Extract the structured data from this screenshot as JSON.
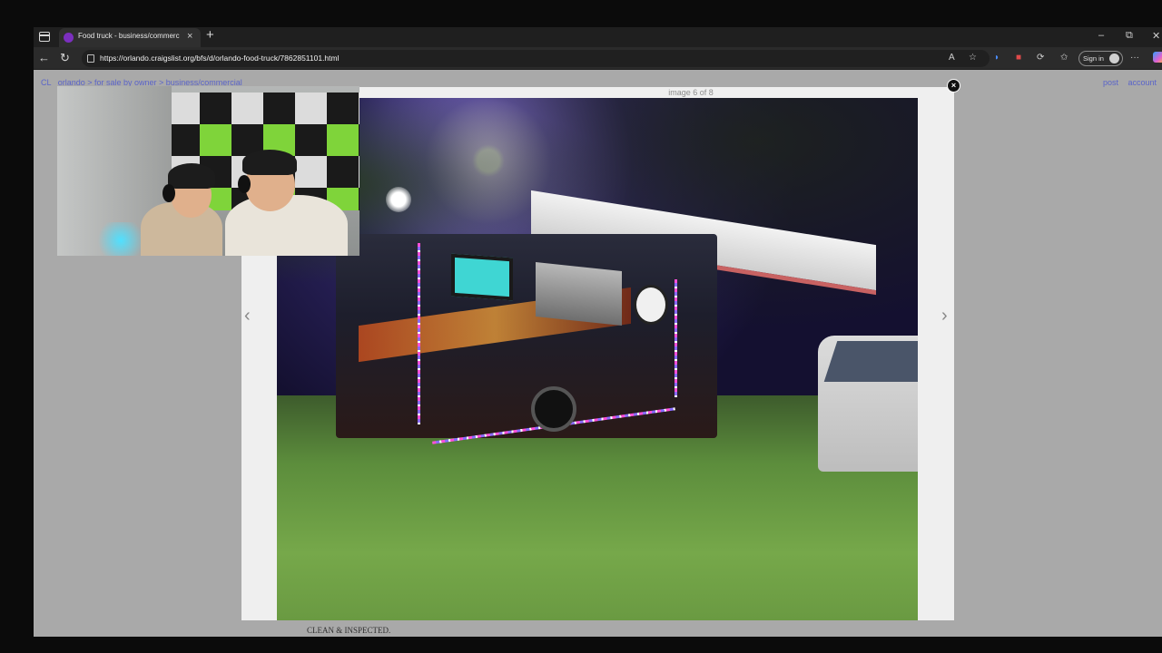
{
  "browser": {
    "tab": {
      "title": "Food truck - business/commercial",
      "close": "×"
    },
    "new_tab": "+",
    "window_controls": {
      "minimize": "–",
      "restore": "⧉",
      "close": "✕"
    },
    "nav": {
      "back": "←",
      "reload": "↻"
    },
    "url": "https://orlando.craigslist.org/bfs/d/orlando-food-truck/7862851101.html",
    "toolbar_icons": [
      "read-aloud-icon",
      "favorite-icon",
      "extension-icon",
      "extension-icon",
      "refresh-icon",
      "favorites-icon"
    ],
    "sign_in": "Sign in",
    "more": "···"
  },
  "page": {
    "breadcrumb": {
      "logo": "CL",
      "text": "orlando > for sale by owner > business/commercial"
    },
    "links": {
      "post": "post",
      "account": "account"
    },
    "lightbox": {
      "counter": "image 6 of 8",
      "prev": "‹",
      "next": "›",
      "close": "×"
    },
    "description": "CLEAN & INSPECTED."
  },
  "colors": {
    "page_bg": "#a9a9a9",
    "link": "#5a64c9",
    "lightbox_bg": "#efefef",
    "browser_chrome": "#2b2b2b"
  }
}
